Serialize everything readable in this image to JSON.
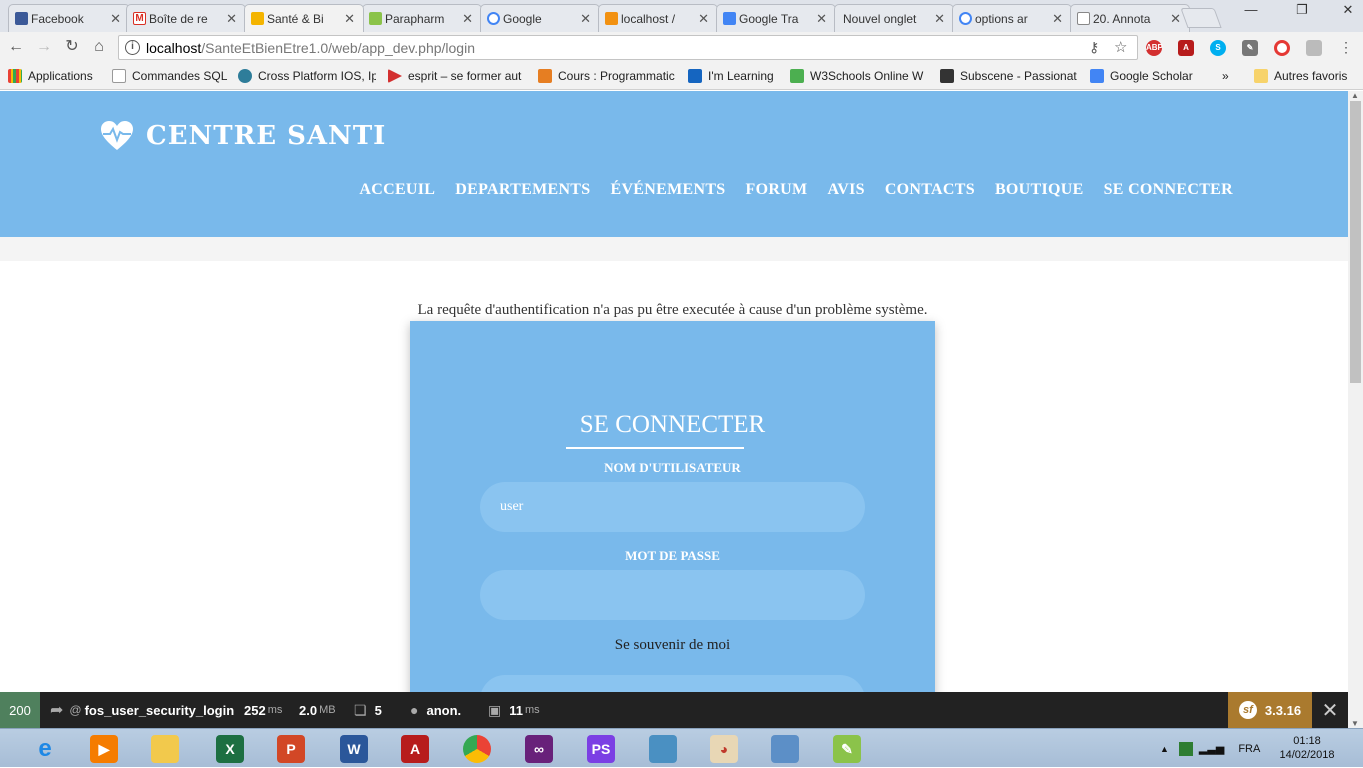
{
  "browser": {
    "tabs": [
      {
        "label": "Facebook",
        "color": "#3b5998"
      },
      {
        "label": "Boîte de re",
        "color": "#d93025"
      },
      {
        "label": "Santé & Bi",
        "color": "#f4b400",
        "active": true
      },
      {
        "label": "Parapharm",
        "color": "#8bc34a"
      },
      {
        "label": "Google",
        "color": "#4285f4"
      },
      {
        "label": "localhost /",
        "color": "#f29111"
      },
      {
        "label": "Google Tra",
        "color": "#4285f4"
      },
      {
        "label": "Nouvel onglet",
        "color": "#cccccc"
      },
      {
        "label": "options ar",
        "color": "#4285f4"
      },
      {
        "label": "20. Annota",
        "color": "#888888"
      }
    ],
    "url_host": "localhost",
    "url_path": "/SanteEtBienEtre1.0/web/app_dev.php/login",
    "bookmarks": [
      {
        "label": "Applications",
        "color": "#e94235"
      },
      {
        "label": "Commandes SQL",
        "color": "#bbbbbb"
      },
      {
        "label": "Cross Platform IOS, Ip",
        "color": "#2e7d9a"
      },
      {
        "label": "esprit – se former aut",
        "color": "#d32f2f"
      },
      {
        "label": "Cours : Programmatic",
        "color": "#e67e22"
      },
      {
        "label": "I'm Learning",
        "color": "#1565c0"
      },
      {
        "label": "W3Schools Online W",
        "color": "#4caf50"
      },
      {
        "label": "Subscene - Passionat",
        "color": "#333333"
      },
      {
        "label": "Google Scholar",
        "color": "#4285f4"
      }
    ],
    "bookmarks_more": "»",
    "other_bookmarks": "Autres favoris"
  },
  "site": {
    "brand": "CENTRE SANTI",
    "nav": [
      "ACCEUIL",
      "DEPARTEMENTS",
      "ÉVÉNEMENTS",
      "FORUM",
      "AVIS",
      "CONTACTS",
      "BOUTIQUE",
      "SE CONNECTER"
    ],
    "error_message": "La requête d'authentification n'a pas pu être executée à cause d'un problème système.",
    "login": {
      "title": "SE CONNECTER",
      "username_label": "NOM D'UTILISATEUR",
      "username_value": "user",
      "password_label": "MOT DE PASSE",
      "password_value": "",
      "remember_label": "Se souvenir de moi"
    },
    "colors": {
      "primary": "#79b9eb",
      "input": "#8ac4f0"
    }
  },
  "symfony_toolbar": {
    "status": "200",
    "route": "fos_user_security_login",
    "time_value": "252",
    "time_unit": "ms",
    "memory_value": "2.0",
    "memory_unit": "MB",
    "queries": "5",
    "user": "anon.",
    "render_value": "11",
    "render_unit": "ms",
    "version": "3.3.16"
  },
  "taskbar": {
    "language": "FRA",
    "time": "01:18",
    "date": "14/02/2018"
  }
}
